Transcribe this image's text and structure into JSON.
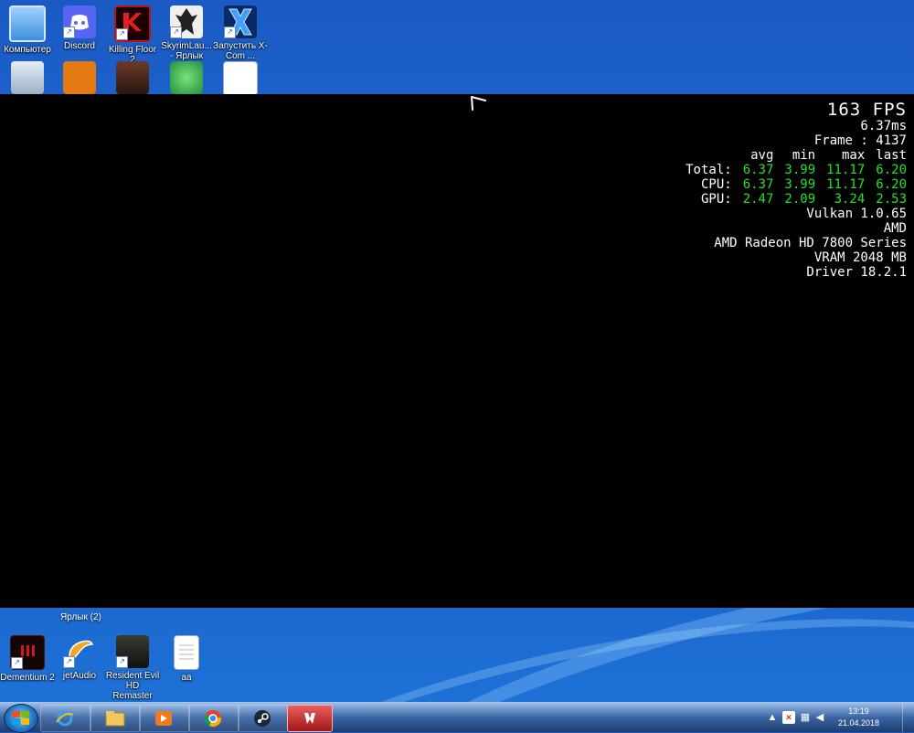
{
  "desktop": {
    "top_icons": [
      {
        "label": "Компьютер",
        "icon": "computer-icon"
      },
      {
        "label": "Discord",
        "icon": "discord-icon"
      },
      {
        "label": "Killing Floor 2",
        "icon": "killing-floor-icon"
      },
      {
        "label": "SkyrimLau... - Ярлык",
        "icon": "skyrim-icon"
      },
      {
        "label": "Запустить X-Com ...",
        "icon": "xcom-icon"
      }
    ],
    "second_row_partial_labels": [
      "",
      "Ярлык (2)"
    ],
    "bottom_icons": [
      {
        "label": "Dementium 2",
        "icon": "dementium-icon"
      },
      {
        "label": "jetAudio",
        "icon": "jetaudio-icon"
      },
      {
        "label": "Resident Evil HD Remaster",
        "icon": "resident-evil-icon"
      },
      {
        "label": "aa",
        "icon": "text-file-icon"
      }
    ]
  },
  "overlay": {
    "fps": "163 FPS",
    "frame_ms": "6.37ms",
    "frame_label": "Frame : 4137",
    "headers": [
      "avg",
      "min",
      "max",
      "last"
    ],
    "rows": [
      {
        "label": "Total:",
        "values": [
          "6.37",
          "3.99",
          "11.17",
          "6.20"
        ]
      },
      {
        "label": "CPU:",
        "values": [
          "6.37",
          "3.99",
          "11.17",
          "6.20"
        ]
      },
      {
        "label": "GPU:",
        "values": [
          "2.47",
          "2.09",
          "3.24",
          "2.53"
        ]
      }
    ],
    "api": "Vulkan 1.0.65",
    "vendor": "AMD",
    "gpu_name": "AMD Radeon HD 7800 Series",
    "vram": "VRAM 2048 MB",
    "driver": "Driver 18.2.1",
    "value_color": "#28e028"
  },
  "taskbar": {
    "clock_time": "13:19",
    "clock_date": "21.04.2018",
    "buttons": [
      "internet-explorer-icon",
      "file-explorer-icon",
      "media-player-icon",
      "chrome-icon",
      "steam-icon",
      "wolfenstein-icon"
    ]
  }
}
